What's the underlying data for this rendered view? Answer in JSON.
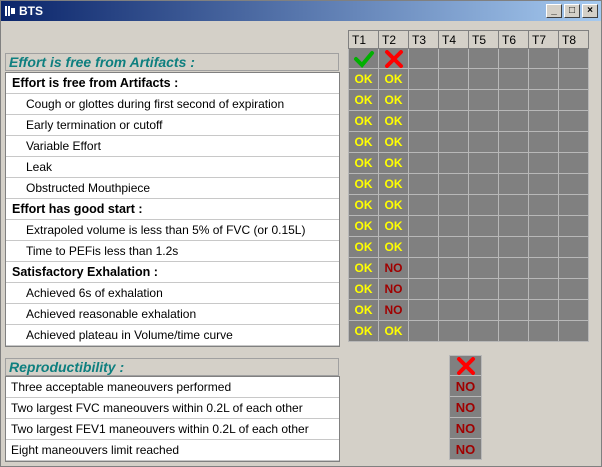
{
  "window": {
    "title": "BTS"
  },
  "trial_headers": [
    "T1",
    "T2",
    "T3",
    "T4",
    "T5",
    "T6",
    "T7",
    "T8"
  ],
  "artifacts": {
    "section_title": "Effort is free from Artifacts :",
    "overall": [
      "check",
      "cross"
    ],
    "rows": [
      {
        "label": "Effort is free from Artifacts :",
        "kind": "group",
        "results": [
          "OK",
          "OK"
        ]
      },
      {
        "label": "Cough or glottes during first second of expiration",
        "kind": "sub",
        "results": [
          "OK",
          "OK"
        ]
      },
      {
        "label": "Early termination or cutoff",
        "kind": "sub",
        "results": [
          "OK",
          "OK"
        ]
      },
      {
        "label": "Variable Effort",
        "kind": "sub",
        "results": [
          "OK",
          "OK"
        ]
      },
      {
        "label": "Leak",
        "kind": "sub",
        "results": [
          "OK",
          "OK"
        ]
      },
      {
        "label": "Obstructed Mouthpiece",
        "kind": "sub",
        "results": [
          "OK",
          "OK"
        ]
      },
      {
        "label": "Effort has good start :",
        "kind": "group",
        "results": [
          "OK",
          "OK"
        ]
      },
      {
        "label": "Extrapoled volume is less than 5% of FVC (or 0.15L)",
        "kind": "sub",
        "results": [
          "OK",
          "OK"
        ]
      },
      {
        "label": "Time to PEFis less than 1.2s",
        "kind": "sub",
        "results": [
          "OK",
          "OK"
        ]
      },
      {
        "label": "Satisfactory Exhalation :",
        "kind": "group",
        "results": [
          "OK",
          "NO"
        ]
      },
      {
        "label": "Achieved 6s of exhalation",
        "kind": "sub",
        "results": [
          "OK",
          "NO"
        ]
      },
      {
        "label": "Achieved reasonable exhalation",
        "kind": "sub",
        "results": [
          "OK",
          "NO"
        ]
      },
      {
        "label": "Achieved plateau in Volume/time curve",
        "kind": "sub",
        "results": [
          "OK",
          "OK"
        ]
      }
    ]
  },
  "reproducibility": {
    "section_title": "Reproductibility :",
    "overall": "cross",
    "rows": [
      {
        "label": "Three acceptable maneouvers performed",
        "result": "NO"
      },
      {
        "label": "Two largest FVC maneouvers within 0.2L of each other",
        "result": "NO"
      },
      {
        "label": "Two largest FEV1 maneouvers within 0.2L of each other",
        "result": "NO"
      },
      {
        "label": "Eight maneouvers limit reached",
        "result": "NO"
      }
    ]
  },
  "colors": {
    "ok": "#ffff00",
    "no": "#a00000",
    "check": "#00b000",
    "cross": "#ff0000",
    "section_text": "#0e7f7f"
  }
}
